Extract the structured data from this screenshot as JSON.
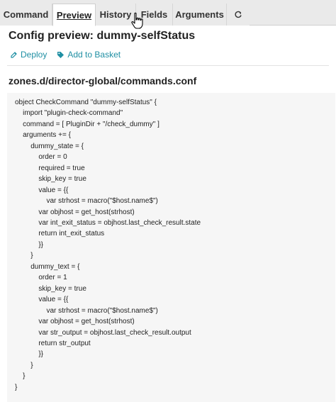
{
  "tabs": [
    {
      "label": "Command",
      "active": false
    },
    {
      "label": "Preview",
      "active": true
    },
    {
      "label": "History",
      "active": false
    },
    {
      "label": "Fields",
      "active": false
    },
    {
      "label": "Arguments",
      "active": false
    }
  ],
  "refresh_icon": "refresh-icon",
  "page_title": "Config preview: dummy-selfStatus",
  "actions": {
    "deploy": {
      "label": "Deploy",
      "icon": "deploy-icon"
    },
    "basket": {
      "label": "Add to Basket",
      "icon": "tag-icon"
    }
  },
  "file_title": "zones.d/director-global/commands.conf",
  "code_lines": [
    "object CheckCommand \"dummy-selfStatus\" {",
    "    import \"plugin-check-command\"",
    "    command = [ PluginDir + \"/check_dummy\" ]",
    "    arguments += {",
    "        dummy_state = {",
    "            order = 0",
    "            required = true",
    "            skip_key = true",
    "            value = {{",
    "                var strhost = macro(\"$host.name$\")",
    "            var objhost = get_host(strhost)",
    "            var int_exit_status = objhost.last_check_result.state",
    "            return int_exit_status",
    "            }}",
    "        }",
    "        dummy_text = {",
    "            order = 1",
    "            skip_key = true",
    "            value = {{",
    "                var strhost = macro(\"$host.name$\")",
    "            var objhost = get_host(strhost)",
    "            var str_output = objhost.last_check_result.output",
    "            return str_output",
    "            }}",
    "        }",
    "    }",
    "}"
  ],
  "colors": {
    "accent": "#1f8fa3",
    "tabbar": "#eaeaea",
    "code_bg": "#f6f6f6"
  }
}
